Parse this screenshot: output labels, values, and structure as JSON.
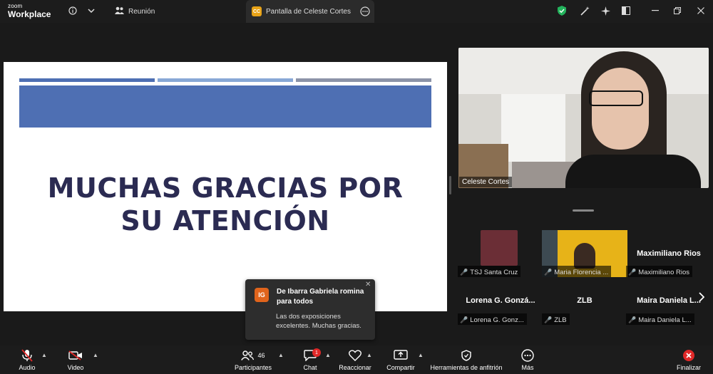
{
  "titlebar": {
    "logo_top": "zoom",
    "logo_bottom": "Workplace",
    "meeting_tab": "Reunión",
    "share_badge": "CC",
    "share_tab": "Pantalla de Celeste Cortes"
  },
  "slide": {
    "title_line1": "MUCHAS GRACIAS POR",
    "title_line2": "SU ATENCIÓN",
    "colors": {
      "bar_big": "#4e6fb3",
      "bar1": "#4e6fb3",
      "bar2": "#88a8d6",
      "bar3": "#8c93a8",
      "title": "#2b2b52"
    }
  },
  "speaker": {
    "name": "Celeste Cortes"
  },
  "participants": [
    {
      "label": "TSJ Santa Cruz",
      "big_name": ""
    },
    {
      "label": "Maria Florencia ...",
      "big_name": ""
    },
    {
      "label": "Maximiliano Rios",
      "big_name": "Maximiliano Rios"
    },
    {
      "label": "Lorena G. Gonz...",
      "big_name": "Lorena G. Gonzá..."
    },
    {
      "label": "ZLB",
      "big_name": "ZLB"
    },
    {
      "label": "Maira Daniela L...",
      "big_name": "Maira  Daniela L..."
    }
  ],
  "chat_toast": {
    "avatar": "IG",
    "sender": "De Ibarra Gabriela romina para todos",
    "message": "Las dos exposiciones excelentes. Muchas gracias."
  },
  "toolbar": {
    "audio": "Audio",
    "video": "Video",
    "participants": "Participantes",
    "participants_count": "46",
    "chat": "Chat",
    "chat_badge": "1",
    "react": "Reaccionar",
    "share": "Compartir",
    "host_tools": "Herramientas de anfitrión",
    "more": "Más",
    "end": "Finalizar"
  }
}
